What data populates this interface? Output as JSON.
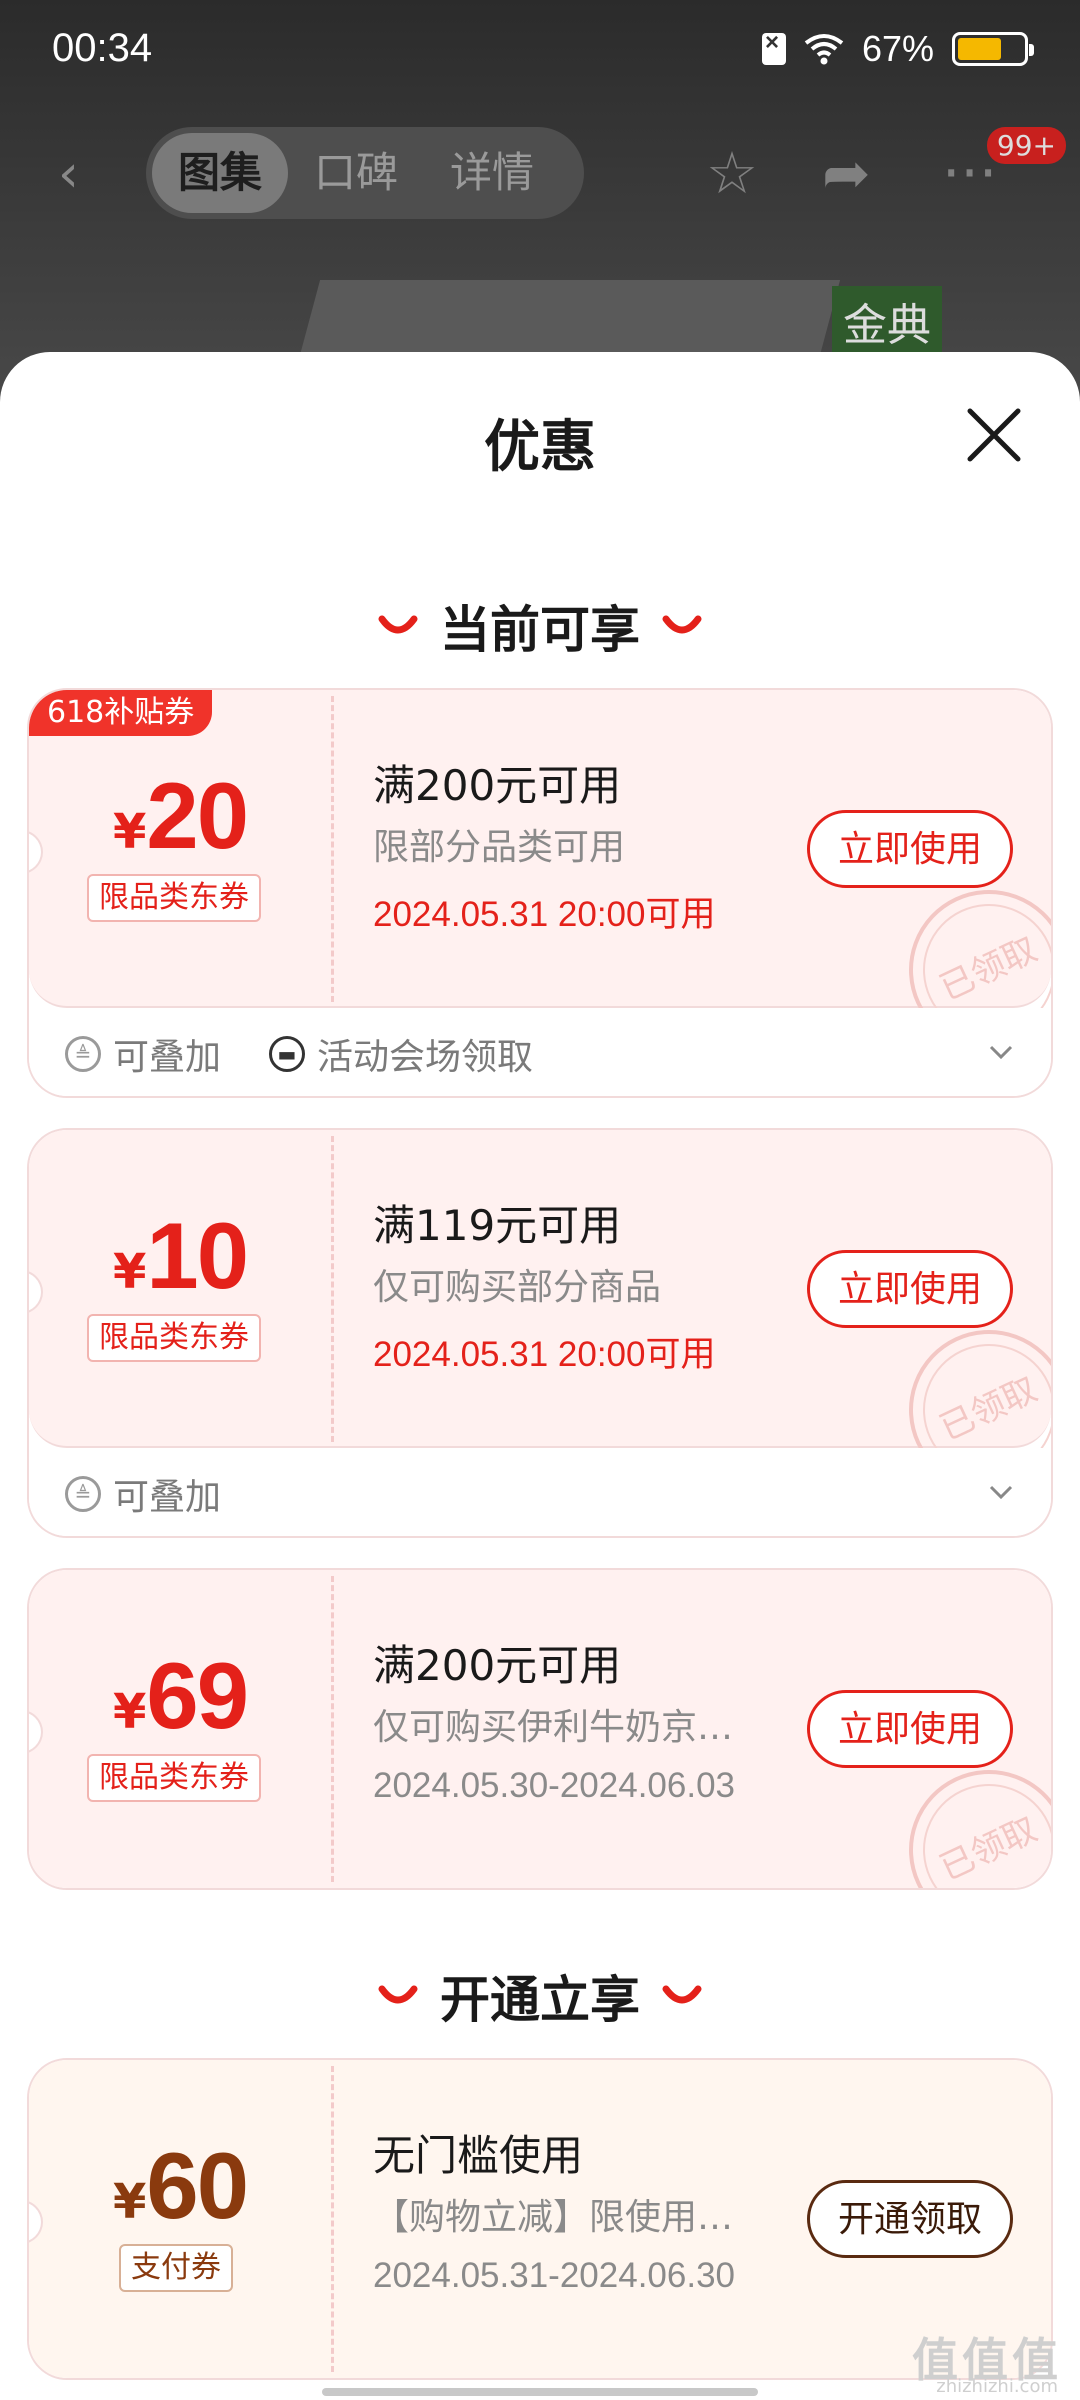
{
  "status_bar": {
    "time": "00:34",
    "battery": "67%",
    "battery_level": 0.67
  },
  "nav": {
    "tabs": [
      {
        "label": "图集"
      },
      {
        "label": "口碑"
      },
      {
        "label": "详情"
      }
    ],
    "badge": "99+",
    "product_logo": "金典"
  },
  "sheet": {
    "title": "优惠",
    "sections": {
      "current": "当前可享",
      "open": "开通立享"
    },
    "coupons": [
      {
        "ribbon": "618补贴券",
        "currency": "¥",
        "amount": "20",
        "tag": "限品类东券",
        "title": "满200元可用",
        "desc": "限部分品类可用",
        "date": "2024.05.31 20:00可用",
        "button": "立即使用",
        "stamp": "已领取",
        "foot": [
          {
            "label": "可叠加",
            "icon": "stack-icon"
          },
          {
            "label": "活动会场领取",
            "icon": "ticket-icon"
          }
        ]
      },
      {
        "currency": "¥",
        "amount": "10",
        "tag": "限品类东券",
        "title": "满119元可用",
        "desc": "仅可购买部分商品",
        "date": "2024.05.31 20:00可用",
        "button": "立即使用",
        "stamp": "已领取",
        "foot": [
          {
            "label": "可叠加",
            "icon": "stack-icon"
          }
        ]
      },
      {
        "currency": "¥",
        "amount": "69",
        "tag": "限品类东券",
        "title": "满200元可用",
        "desc": "仅可购买伊利牛奶京…",
        "date": "2024.05.30-2024.06.03",
        "button": "立即使用",
        "stamp": "已领取"
      },
      {
        "currency": "¥",
        "amount": "60",
        "tag": "支付券",
        "title": "无门槛使用",
        "desc": "【购物立减】限使用…",
        "date": "2024.05.31-2024.06.30",
        "button": "开通领取"
      }
    ]
  },
  "watermark": {
    "text": "值值值",
    "sub": "zhizhizhi.com"
  },
  "colors": {
    "accent_red": "#e4211a",
    "brown": "#8a3a0e",
    "card_bg": "#fff1f0"
  }
}
